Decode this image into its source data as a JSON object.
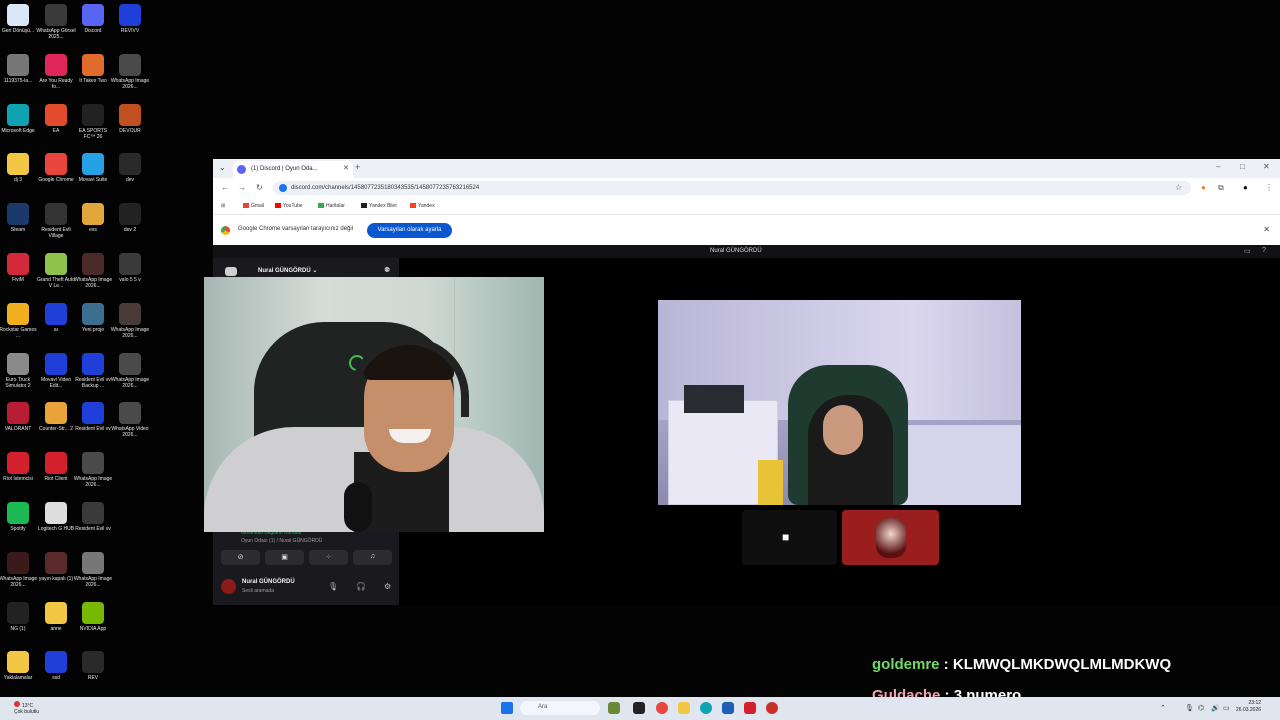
{
  "desktop": {
    "icons": [
      {
        "label": "Geri Dönüşü...",
        "color": "#d8e6f5"
      },
      {
        "label": "WhatsApp Görsel 2025...",
        "color": "#3a3a3a"
      },
      {
        "label": "Discord",
        "color": "#5865f2"
      },
      {
        "label": "REVIVV",
        "color": "#1f3fd8"
      },
      {
        "label": "1119375-la...",
        "color": "#777777"
      },
      {
        "label": "Are You Ready fo...",
        "color": "#e0265a"
      },
      {
        "label": "It Takes Two",
        "color": "#e06b2a"
      },
      {
        "label": "WhatsApp Image 2026...",
        "color": "#4a4a4a"
      },
      {
        "label": "Microsoft Edge",
        "color": "#0fa3b1"
      },
      {
        "label": "EA",
        "color": "#e24a2b"
      },
      {
        "label": "EA SPORTS FC™ 26",
        "color": "#222222"
      },
      {
        "label": "DEVOUR",
        "color": "#c0501f"
      },
      {
        "label": "dj 3",
        "color": "#f3c744"
      },
      {
        "label": "Google Chrome",
        "color": "#e8453c"
      },
      {
        "label": "Movavi Suite",
        "color": "#27a1e6"
      },
      {
        "label": "dev",
        "color": "#2a2a2a"
      },
      {
        "label": "Steam",
        "color": "#1b3a6b"
      },
      {
        "label": "Resident Evil Village",
        "color": "#333333"
      },
      {
        "label": "ess",
        "color": "#e2a73a"
      },
      {
        "label": "dev 2",
        "color": "#222222"
      },
      {
        "label": "FiviM",
        "color": "#d4283b"
      },
      {
        "label": "Grand Theft Auto V Le...",
        "color": "#8fc24a"
      },
      {
        "label": "WhatsApp Image 2026...",
        "color": "#4b2a2a"
      },
      {
        "label": "valo 5 5 v",
        "color": "#3a3a3a"
      },
      {
        "label": "Rockstar Games ...",
        "color": "#f2b01e"
      },
      {
        "label": "aı",
        "color": "#1f3fd8"
      },
      {
        "label": "Yeni proje",
        "color": "#3c6f8f"
      },
      {
        "label": "WhatsApp Image 2026...",
        "color": "#4a3a3a"
      },
      {
        "label": "Euro Truck Simulator 2",
        "color": "#8a8a8a"
      },
      {
        "label": "Movavi Video Edit...",
        "color": "#1f3fd8"
      },
      {
        "label": "Resident Evil vv Backup ...",
        "color": "#1f3fd8"
      },
      {
        "label": "WhatsApp Image 2026...",
        "color": "#4a4a4a"
      },
      {
        "label": "VALORANT",
        "color": "#b81d33"
      },
      {
        "label": "Counter-Str... 2",
        "color": "#e8a33a"
      },
      {
        "label": "Resident Evil vv",
        "color": "#1f3fd8"
      },
      {
        "label": "WhatsApp Video 2026...",
        "color": "#4a4a4a"
      },
      {
        "label": "Riot İstemcisi",
        "color": "#d41f2c"
      },
      {
        "label": "Riot Client",
        "color": "#d41f2c"
      },
      {
        "label": "WhatsApp Image 2026...",
        "color": "#4a4a4a"
      },
      {
        "label": "",
        "color": "transparent"
      },
      {
        "label": "Spotify",
        "color": "#1db954"
      },
      {
        "label": "Logitech G HUB",
        "color": "#dddddd"
      },
      {
        "label": "Resident Evil vv",
        "color": "#3a3a3a"
      },
      {
        "label": "",
        "color": "transparent"
      },
      {
        "label": "WhatsApp Image 2026...",
        "color": "#3a1a1a"
      },
      {
        "label": "yayın kapalı (1)",
        "color": "#5a2a2a"
      },
      {
        "label": "WhatsApp Image 2026...",
        "color": "#777777"
      },
      {
        "label": "",
        "color": "transparent"
      },
      {
        "label": "NG (1)",
        "color": "#222222"
      },
      {
        "label": "anne",
        "color": "#f3c744"
      },
      {
        "label": "NVIDIA App",
        "color": "#76b900"
      },
      {
        "label": "",
        "color": "transparent"
      },
      {
        "label": "Yaklalamalar",
        "color": "#f3c744"
      },
      {
        "label": "ssd",
        "color": "#1f3fd8"
      },
      {
        "label": "REV",
        "color": "#2a2a2a"
      }
    ]
  },
  "browser": {
    "tab_title": "(1) Discord | Oyun Oda...",
    "new_tab": "+",
    "url": "discord.com/channels/1458077235180343535/1458077235763216524",
    "bookmarks": [
      {
        "label": "Gmail",
        "color": "#ea4335"
      },
      {
        "label": "YouTube",
        "color": "#ff0000"
      },
      {
        "label": "Haritalar",
        "color": "#34a853"
      },
      {
        "label": "Yandex Bilet",
        "color": "#222222"
      },
      {
        "label": "Yandex",
        "color": "#fc3f1d"
      }
    ],
    "infobar_message": "Google Chrome varsayılan tarayıcınız değil",
    "infobar_button": "Varsayılan olarak ayarla",
    "close": "✕"
  },
  "discord": {
    "window_title": "Nural GÜNGÖRDÜ",
    "server_name": "Nural GÜNGÖRDÜ ⌄",
    "voice_status": "Görüntülü Bağlantı Kuruldu",
    "voice_channel": "Oyun Odası (1) / Nural GÜNGÖRDÜ",
    "username": "Nural GÜNGÖRDÜ",
    "user_status": "Sesli aramada"
  },
  "chat": [
    {
      "user": "goldemre",
      "sep": " : ",
      "text": "KLMWQLMKDWQLMLMDKWQ"
    },
    {
      "user": "Guldache",
      "sep": " : ",
      "text": "3 numero"
    }
  ],
  "taskbar": {
    "weather_line1": "13°C",
    "weather_line2": "Çok bulutlu",
    "search_placeholder": "Ara",
    "time": "23:12",
    "date": "26.03.2026"
  }
}
